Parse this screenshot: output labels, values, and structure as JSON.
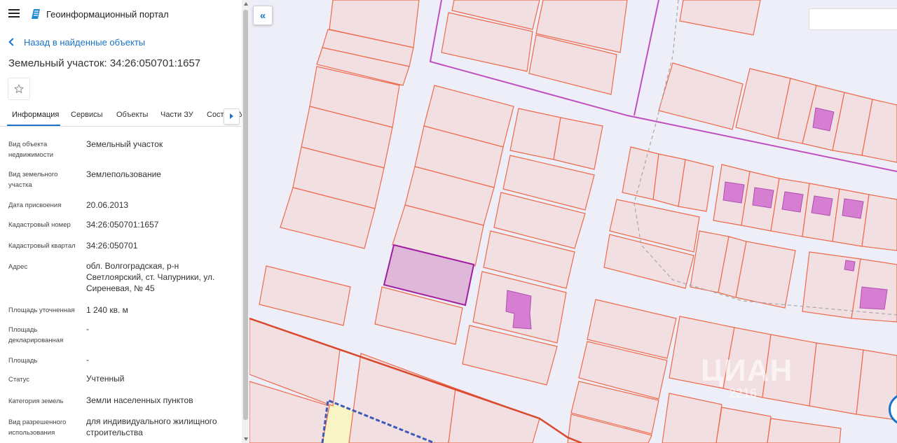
{
  "header": {
    "app_title": "Геоинформационный портал"
  },
  "nav": {
    "back_label": "Назад в найденные объекты"
  },
  "object": {
    "title": "Земельный участок: 34:26:050701:1657"
  },
  "tabs": [
    {
      "label": "Информация"
    },
    {
      "label": "Сервисы"
    },
    {
      "label": "Объекты"
    },
    {
      "label": "Части ЗУ"
    },
    {
      "label": "Состав ЗУ"
    }
  ],
  "properties": [
    {
      "label": "Вид объекта недвижимости",
      "value": "Земельный участок"
    },
    {
      "label": "Вид земельного участка",
      "value": "Землепользование"
    },
    {
      "label": "Дата присвоения",
      "value": "20.06.2013"
    },
    {
      "label": "Кадастровый номер",
      "value": "34:26:050701:1657"
    },
    {
      "label": "Кадастровый квартал",
      "value": "34:26:050701"
    },
    {
      "label": "Адрес",
      "value": "обл. Волгоградская, р-н Светлоярский, ст. Чапурники, ул. Сиреневая, № 45"
    },
    {
      "label": "Площадь уточненная",
      "value": "1 240 кв. м"
    },
    {
      "label": "Площадь декларированная",
      "value": "-"
    },
    {
      "label": "Площадь",
      "value": "-"
    },
    {
      "label": "Статус",
      "value": "Учтенный"
    },
    {
      "label": "Категория земель",
      "value": "Земли населенных пунктов"
    },
    {
      "label": "Вид разрешенного использования",
      "value": "для индивидуального жилищного строительства"
    }
  ],
  "map": {
    "watermark": "ЦИАН",
    "watermark_number": "2216",
    "colors": {
      "background": "#edeef7",
      "parcel_fill": "#f2dfe2",
      "parcel_stroke": "#ee6a4c",
      "selected_fill": "#dfb7d9",
      "selected_stroke": "#a01fa0",
      "building_fill": "#d67ed2",
      "boundary_purple": "#c04fc0",
      "boundary_red": "#d9492e",
      "boundary_blue_dashed": "#3d59b8",
      "yellow_zone": "#f8f4c6"
    }
  }
}
